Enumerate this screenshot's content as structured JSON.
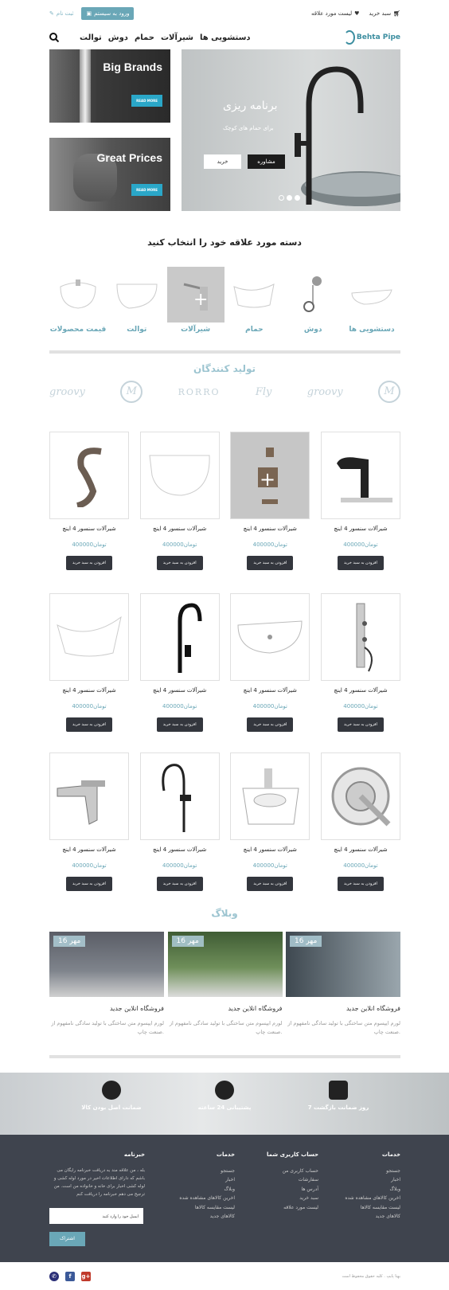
{
  "topbar": {
    "login": "ورود به سیستم",
    "signup": "ثبت نام",
    "wishlist": "لیست مورد علاقه",
    "cart": "سبد خرید"
  },
  "nav": {
    "items": [
      "توالت",
      "دوش",
      "حمام",
      "شیرآلات",
      "دستشویی ها"
    ],
    "logo": "Behta Pipe"
  },
  "promos": {
    "brands_title": "Big Brands",
    "prices_title": "Great Prices",
    "read_more": "READ MORE"
  },
  "hero": {
    "title": "برنامه ریزی",
    "subtitle": "برای حمام های کوچک",
    "buy": "خرید",
    "consult": "مشاوره"
  },
  "categories": {
    "title": "دسته مورد علاقه خود را انتخاب کنید",
    "items": [
      "قیمت محصولات",
      "توالت",
      "شیرآلات",
      "حمام",
      "دوش",
      "دستشویی ها"
    ]
  },
  "brands": {
    "title": "تولید کنندگان",
    "logos": [
      "groovy",
      "M",
      "RORRO",
      "Fly",
      "groovy",
      "M"
    ]
  },
  "products": {
    "title": "شیرآلات سنسور 4 اینچ",
    "price": "400000تومان",
    "button": "افزودن به سبد خرید"
  },
  "blog": {
    "title": "وبلاگ",
    "date": "16 مهر",
    "post_title": "فروشگاه انلاین جدید",
    "post_desc": "لورم ایپسوم متن ساختگی با تولید سادگی نامفهوم از صنعت چاپ."
  },
  "features": {
    "items": [
      "ضمانت اصل بودن کالا",
      "پشتیبانی 24 ساعته",
      "7 روز ضمانت بازگشت"
    ]
  },
  "footer": {
    "newsletter_title": "خبرنامه",
    "newsletter_text": "بله ، من علاقه مند به دریافت خبرنامه رایگان می باشم که دارای اطلاعات اخیر در مورد لوله کشی و لوله کشی اخبار برای خانه و خانواده من است. من ترجیح می دهم خبرنامه را دریافت کنم",
    "email_placeholder": "ایمیل خود را وارد کنید",
    "subscribe": "اشتراک",
    "col_services_title": "خدمات",
    "col_services": [
      "جستجو",
      "اخبار",
      "وبلاگ",
      "اخرین کالاهای مشاهده شده",
      "لیست مقایسه کالاها",
      "کالاهای جدید"
    ],
    "col_account_title": "حساب کاربری شما",
    "col_account": [
      "حساب کاربری من",
      "سفارشات",
      "آدرس ها",
      "سبد خرید",
      "لیست مورد علاقه"
    ],
    "col_services2_title": "خدمات",
    "col_services2": [
      "جستجو",
      "اخبار",
      "وبلاگ",
      "اخرین کالاهای مشاهده شده",
      "لیست مقایسه کالاها",
      "کالاهای جدید"
    ],
    "copyright": "بهتا پایپ . کلیه حقوق محفوظ است"
  },
  "colors": {
    "accent": "#6aa7b7",
    "dark": "#33363d",
    "footer": "#3f444e"
  }
}
